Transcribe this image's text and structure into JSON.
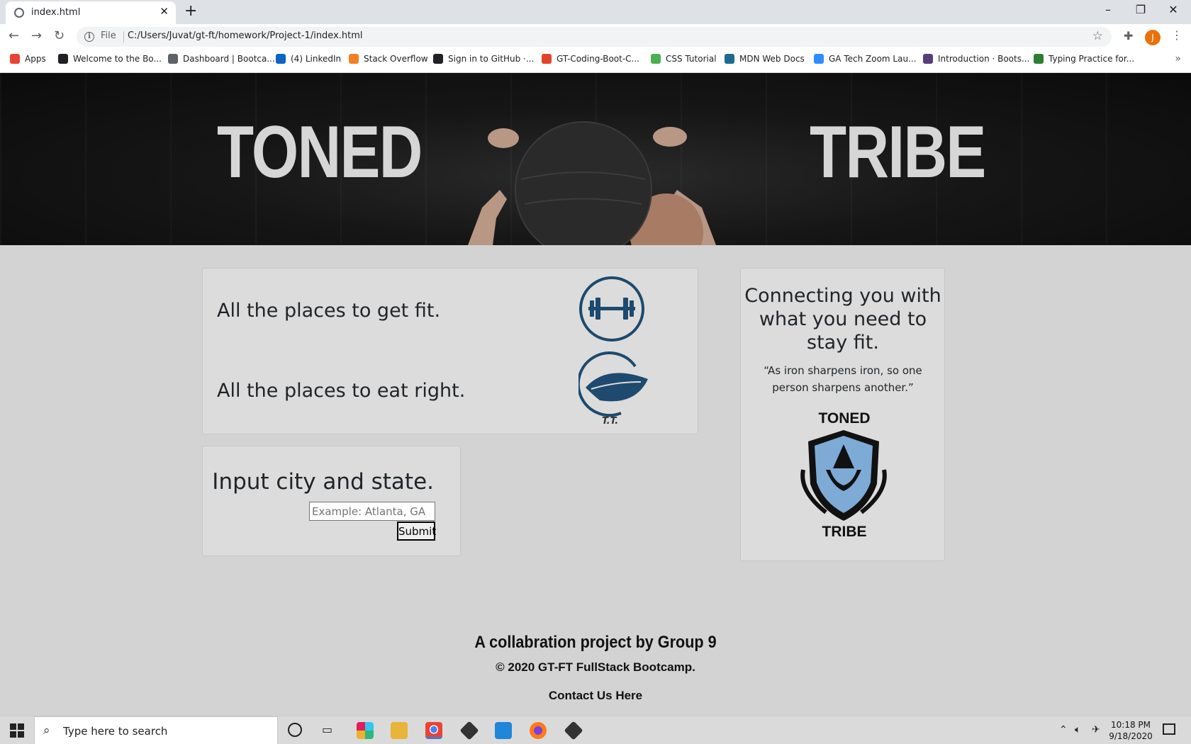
{
  "browser": {
    "tab_title": "index.html",
    "address_scheme": "File",
    "address_url": "C:/Users/Juvat/gt-ft/homework/Project-1/index.html",
    "profile_initial": "J",
    "bookmarks": [
      {
        "label": "Apps",
        "color": "#ea4335"
      },
      {
        "label": "Welcome to the Bo...",
        "color": "#202124"
      },
      {
        "label": "Dashboard | Bootca...",
        "color": "#5f6368"
      },
      {
        "label": "(4) LinkedIn",
        "color": "#0a66c2"
      },
      {
        "label": "Stack Overflow",
        "color": "#f48024"
      },
      {
        "label": "Sign in to GitHub ·...",
        "color": "#202124"
      },
      {
        "label": "GT-Coding-Boot-C...",
        "color": "#e24329"
      },
      {
        "label": "CSS Tutorial",
        "color": "#4caf50"
      },
      {
        "label": "MDN Web Docs",
        "color": "#1b6c8e"
      },
      {
        "label": "GA Tech Zoom Lau...",
        "color": "#2d8cff"
      },
      {
        "label": "Introduction · Boots...",
        "color": "#563d7c"
      },
      {
        "label": "Typing Practice for...",
        "color": "#2e7d32"
      }
    ]
  },
  "hero": {
    "left_word": "TONED",
    "right_word": "TRIBE"
  },
  "places": {
    "fit": "All the places to get fit.",
    "eat": "All the places to eat right.",
    "logo_caption": "T.T."
  },
  "search": {
    "title": "Input city and state.",
    "placeholder": "Example: Atlanta, GA",
    "submit": "Submit"
  },
  "side": {
    "title": "Connecting you with what you need to stay fit.",
    "quote": "“As iron sharpens iron, so one person sharpens another.”",
    "logo_top": "TONED",
    "logo_bottom": "TRIBE"
  },
  "footer": {
    "title": "A collabration project by Group 9",
    "copyright": "© 2020 GT-FT FullStack Bootcamp.",
    "contact": "Contact Us Here"
  },
  "taskbar": {
    "search_placeholder": "Type here to search",
    "time": "10:18 PM",
    "date": "9/18/2020"
  },
  "colors": {
    "accent_navy": "#1d4a6e",
    "page_bg": "#d3d3d3",
    "card_bg": "#dcdcdc"
  }
}
